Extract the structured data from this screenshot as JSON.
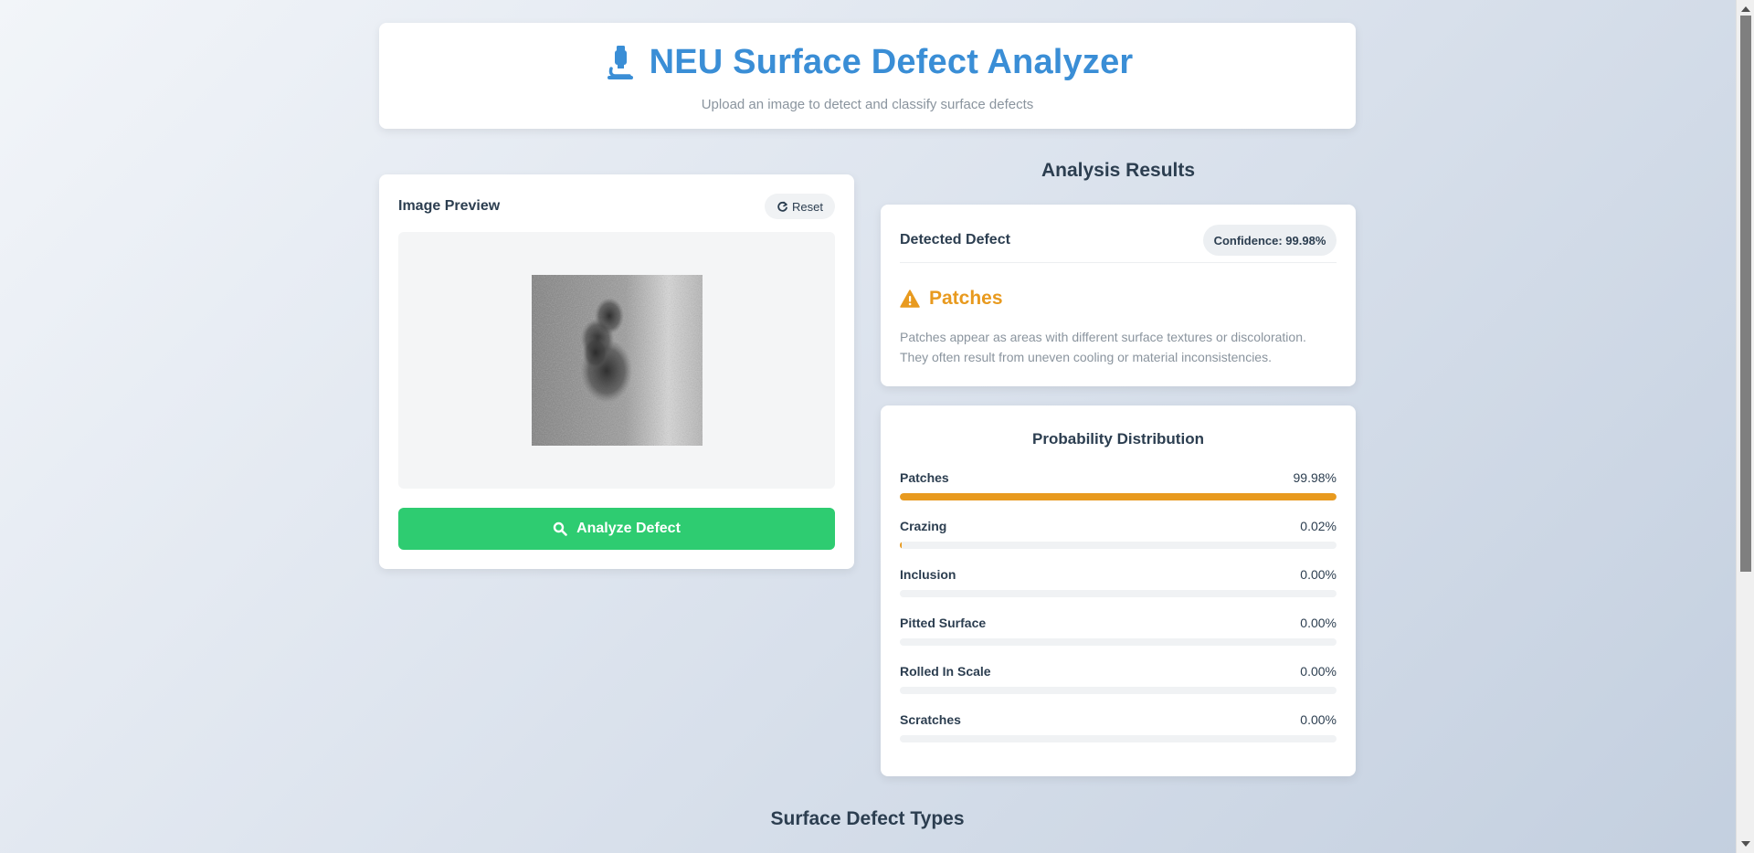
{
  "header": {
    "title": "NEU Surface Defect Analyzer",
    "subtitle": "Upload an image to detect and classify surface defects",
    "icon": "microscope-icon"
  },
  "preview": {
    "title": "Image Preview",
    "reset_label": "Reset",
    "reset_icon": "refresh-icon",
    "analyze_label": "Analyze Defect",
    "analyze_icon": "search-icon"
  },
  "results": {
    "title": "Analysis Results",
    "detected_label": "Detected Defect",
    "confidence": "Confidence: 99.98%",
    "defect_name": "Patches",
    "defect_icon": "warning-icon",
    "description": "Patches appear as areas with different surface textures or discoloration. They often result from uneven cooling or material inconsistencies."
  },
  "probability": {
    "title": "Probability Distribution",
    "items": [
      {
        "label": "Patches",
        "value": "99.98%",
        "fraction": 0.9998
      },
      {
        "label": "Crazing",
        "value": "0.02%",
        "fraction": 0.0002
      },
      {
        "label": "Inclusion",
        "value": "0.00%",
        "fraction": 0
      },
      {
        "label": "Pitted Surface",
        "value": "0.00%",
        "fraction": 0
      },
      {
        "label": "Rolled In Scale",
        "value": "0.00%",
        "fraction": 0
      },
      {
        "label": "Scratches",
        "value": "0.00%",
        "fraction": 0
      }
    ]
  },
  "footer": {
    "title": "Surface Defect Types"
  },
  "colors": {
    "accent": "#3a8ed6",
    "success": "#2ecc71",
    "warning": "#e89a1f",
    "text": "#2c3e50",
    "muted": "#8a949e"
  }
}
